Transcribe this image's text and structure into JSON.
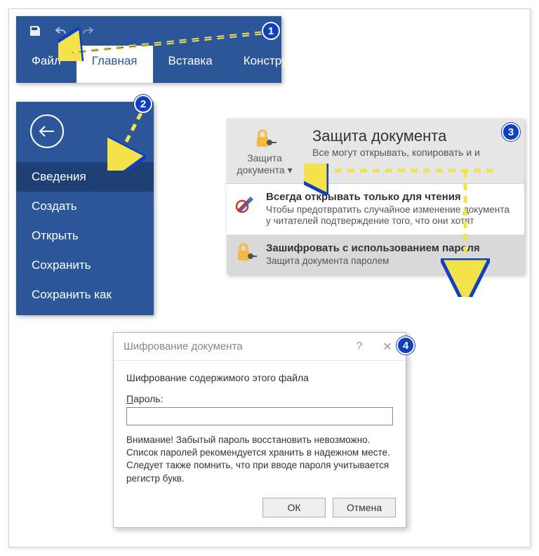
{
  "ribbon": {
    "tabs": [
      "Файл",
      "Главная",
      "Вставка",
      "Конструк"
    ]
  },
  "filemenu": {
    "items": [
      "Сведения",
      "Создать",
      "Открыть",
      "Сохранить",
      "Сохранить как"
    ]
  },
  "protect": {
    "btn_label_line1": "Защита",
    "btn_label_line2": "документа",
    "title": "Защита документа",
    "subtitle": "Все могут открывать, копировать и и",
    "opt1_title": "Всегда открывать только для чтения",
    "opt1_desc": "Чтобы предотвратить случайное изменение документа у читателей подтверждение того, что они хотят",
    "opt2_title": "Зашифровать с использованием пароля",
    "opt2_desc": "Защита документа паролем"
  },
  "dialog": {
    "title": "Шифрование документа",
    "heading": "Шифрование содержимого этого файла",
    "pwd_label_u": "П",
    "pwd_label_rest": "ароль:",
    "warning": "Внимание! Забытый пароль восстановить невозможно. Список паролей рекомендуется хранить в надежном месте.\nСледует также помнить, что при вводе пароля учитывается регистр букв.",
    "ok": "ОК",
    "cancel": "Отмена"
  },
  "badges": [
    "1",
    "2",
    "3",
    "4"
  ]
}
